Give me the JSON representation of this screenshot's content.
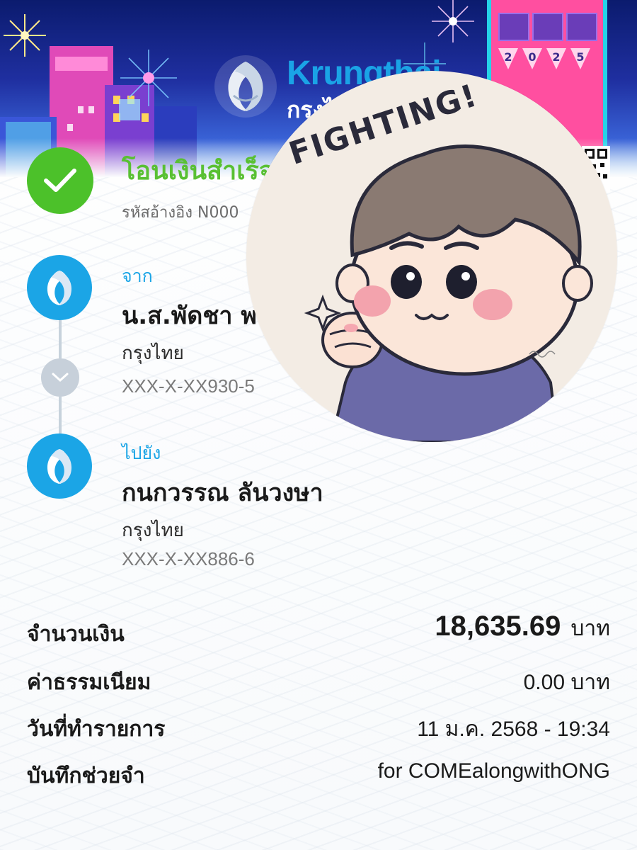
{
  "brand": {
    "name_en": "Krungthai",
    "name_th": "กรุงไทย",
    "sign_year": [
      "2",
      "0",
      "2",
      "5"
    ]
  },
  "status": {
    "title": "โอนเงินสำเร็จ",
    "reference": "รหัสอ้างอิง N000"
  },
  "sender": {
    "label": "จาก",
    "name": "น.ส.พัดชา พ",
    "bank": "กรุงไทย",
    "account": "XXX-X-XX930-5"
  },
  "receiver": {
    "label": "ไปยัง",
    "name": "กนกวรรณ ลันวงษา",
    "bank": "กรุงไทย",
    "account": "XXX-X-XX886-6"
  },
  "details": {
    "amount_label": "จำนวนเงิน",
    "amount_value": "18,635.69",
    "amount_unit": "บาท",
    "fee_label": "ค่าธรรมเนียม",
    "fee_value": "0.00 บาท",
    "date_label": "วันที่ทำรายการ",
    "date_value": "11 ม.ค. 2568 - 19:34",
    "memo_label": "บันทึกช่วยจำ",
    "memo_value": "for COMEalongwithONG"
  },
  "sticker": {
    "text": "FIGHTING!",
    "signature": "Yingnin"
  },
  "colors": {
    "success_green": "#4cc12a",
    "brand_blue": "#1ba5e6",
    "title_green": "#59c033"
  },
  "icons": [
    "check-icon",
    "krungthai-logo-icon",
    "chevron-down-icon",
    "sparkle-icon"
  ]
}
